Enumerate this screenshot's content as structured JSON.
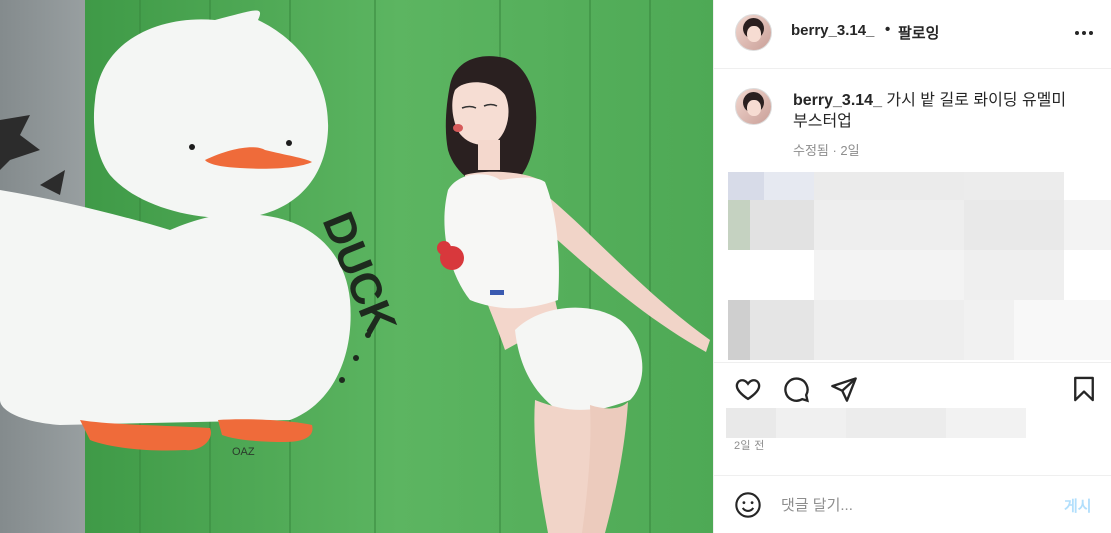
{
  "post": {
    "username": "berry_3.14_",
    "separator": "•",
    "follow_label": "팔로잉",
    "more_icon": "more-horizontal-icon"
  },
  "caption": {
    "username": "berry_3.14_",
    "text": "가시 밭 길로 롸이딩 유멜미 부스터업",
    "meta": "수정됨 · 2일"
  },
  "photo": {
    "graffiti_text": "DUCK",
    "signature": "OAZ",
    "alt": "Woman in white crop top and shorts posing beside a duck mural on a green wall"
  },
  "actions": {
    "like_icon": "heart-icon",
    "comment_icon": "comment-icon",
    "share_icon": "send-icon",
    "save_icon": "bookmark-icon"
  },
  "timestamp": "2일 전",
  "comment_box": {
    "emoji_icon": "emoji-icon",
    "placeholder": "댓글 달기...",
    "post_label": "게시"
  },
  "colors": {
    "wall_green": "#4faa55",
    "link_disabled": "#b2dffc",
    "meta_gray": "#8e8e8e",
    "border": "#efefef"
  }
}
